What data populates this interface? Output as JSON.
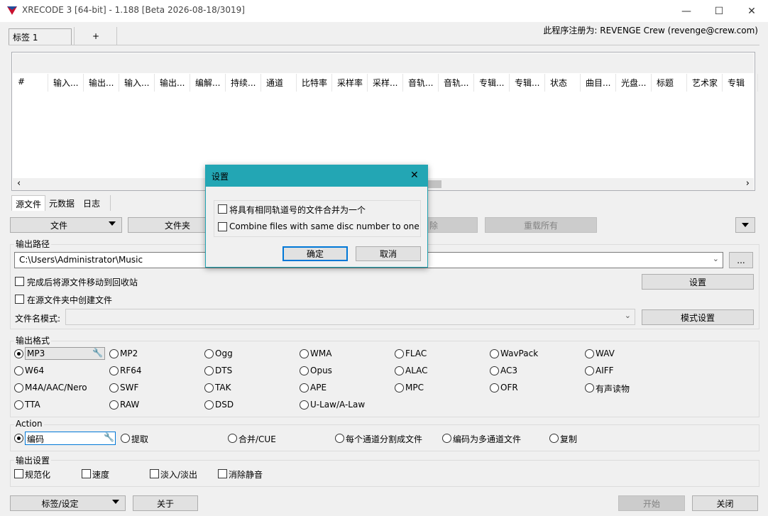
{
  "window": {
    "title": "XRECODE 3 [64-bit] - 1.188 [Beta 2026-08-18/3019]",
    "minimize": "—",
    "maximize": "☐",
    "close": "✕"
  },
  "tabs": {
    "tab1": "标签 1",
    "add": "+"
  },
  "registration": "此程序注册为: REVENGE Crew (revenge@crew.com)",
  "columns": [
    "#",
    "输入...",
    "输出...",
    "输入...",
    "输出...",
    "编解...",
    "持续...",
    "通道",
    "比特率",
    "采样率",
    "采样...",
    "音轨...",
    "音轨...",
    "专辑...",
    "专辑...",
    "状态",
    "曲目...",
    "光盘...",
    "标题",
    "艺术家",
    "专辑"
  ],
  "scroll": {
    "left": "‹",
    "right": "›"
  },
  "source_tabs": [
    "源文件",
    "元数据",
    "日志"
  ],
  "toolbar": {
    "files": "文件",
    "folder": "文件夹",
    "remove": "除",
    "reload_all": "重载所有"
  },
  "output_path": {
    "label": "输出路径",
    "value": "C:\\Users\\Administrator\\Music",
    "browse": "...",
    "move_to_recycle": "完成后将源文件移动到回收站",
    "create_in_source": "在源文件夹中创建文件",
    "settings": "设置",
    "filename_pattern": "文件名模式:",
    "pattern_settings": "模式设置"
  },
  "output_format": {
    "label": "输出格式",
    "selected": "MP3",
    "options": [
      "MP3",
      "MP2",
      "Ogg",
      "WMA",
      "FLAC",
      "WavPack",
      "WAV",
      "W64",
      "RF64",
      "DTS",
      "Opus",
      "ALAC",
      "AC3",
      "AIFF",
      "M4A/AAC/Nero",
      "SWF",
      "TAK",
      "APE",
      "MPC",
      "OFR",
      "有声读物",
      "TTA",
      "RAW",
      "DSD",
      "U-Law/A-Law"
    ]
  },
  "action": {
    "label": "Action",
    "options": [
      "编码",
      "提取",
      "合并/CUE",
      "每个通道分割成文件",
      "编码为多通道文件",
      "复制"
    ]
  },
  "output_settings": {
    "label": "输出设置",
    "options": [
      "规范化",
      "速度",
      "淡入/淡出",
      "消除静音"
    ]
  },
  "bottom": {
    "tags": "标签/设定",
    "about": "关于",
    "start": "开始",
    "close": "关闭"
  },
  "dialog": {
    "title": "设置",
    "close": "✕",
    "opt1": "将具有相同轨道号的文件合并为一个",
    "opt2": "Combine files with same disc number to one",
    "ok": "确定",
    "cancel": "取消"
  }
}
